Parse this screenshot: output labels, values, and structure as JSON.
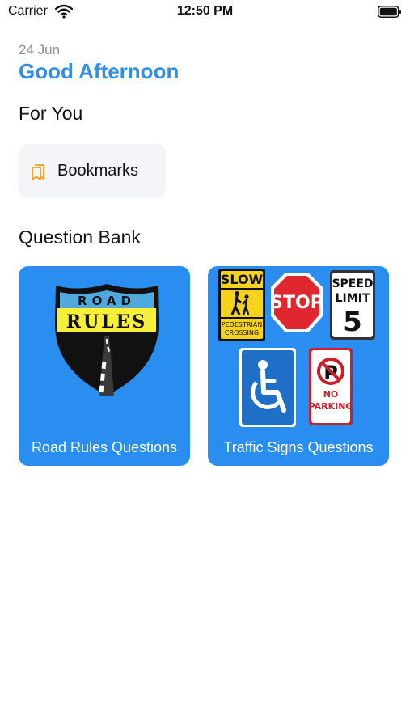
{
  "status_bar": {
    "carrier": "Carrier",
    "time": "12:50 PM",
    "wifi_icon": "wifi-icon",
    "battery_icon": "battery-icon"
  },
  "header": {
    "date": "24 Jun",
    "greeting": "Good Afternoon"
  },
  "for_you": {
    "title": "For You",
    "bookmarks": {
      "label": "Bookmarks",
      "icon": "bookmark-icon"
    }
  },
  "question_bank": {
    "title": "Question Bank",
    "cards": [
      {
        "label": "Road Rules Questions",
        "shield_top": "ROAD",
        "shield_middle": "RULES"
      },
      {
        "label": "Traffic Signs Questions",
        "signs": {
          "slow": "SLOW",
          "ped1": "PEDESTRIAN",
          "ped2": "CROSSING",
          "stop": "STOP",
          "speed1": "SPEED",
          "speed2": "LIMIT",
          "speed_num": "5",
          "p": "P",
          "no": "NO",
          "parking": "PARKING"
        }
      }
    ]
  },
  "colors": {
    "accent": "#2e8ee8",
    "card_blue": "#2a8ef0",
    "bookmark_orange": "#f0a020",
    "stop_red": "#e0262e"
  }
}
